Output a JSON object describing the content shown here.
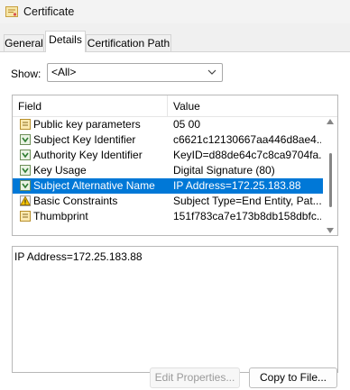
{
  "window": {
    "title": "Certificate",
    "icon": "certificate-icon"
  },
  "tabs": [
    {
      "label": "General",
      "active": false
    },
    {
      "label": "Details",
      "active": true
    },
    {
      "label": "Certification Path",
      "active": false
    }
  ],
  "show": {
    "label": "Show:",
    "selected": "<All>"
  },
  "list": {
    "columns": {
      "field": "Field",
      "value": "Value"
    },
    "rows": [
      {
        "field": "Public key parameters",
        "value": "05 00",
        "icon": "property-icon",
        "selected": false
      },
      {
        "field": "Subject Key Identifier",
        "value": "c6621c12130667aa446d8ae4...",
        "icon": "extension-icon",
        "selected": false
      },
      {
        "field": "Authority Key Identifier",
        "value": "KeyID=d88de64c7c8ca9704fa...",
        "icon": "extension-icon",
        "selected": false
      },
      {
        "field": "Key Usage",
        "value": "Digital Signature (80)",
        "icon": "extension-icon",
        "selected": false
      },
      {
        "field": "Subject Alternative Name",
        "value": "IP Address=172.25.183.88",
        "icon": "extension-icon",
        "selected": true
      },
      {
        "field": "Basic Constraints",
        "value": "Subject Type=End Entity, Pat...",
        "icon": "warning-extension-icon",
        "selected": false
      },
      {
        "field": "Thumbprint",
        "value": "151f783ca7e173b8db158dbfc...",
        "icon": "property-icon",
        "selected": false
      }
    ]
  },
  "detail_text": "IP Address=172.25.183.88",
  "buttons": {
    "edit_properties": "Edit Properties...",
    "copy_to_file": "Copy to File..."
  },
  "colors": {
    "selection": "#0078d7",
    "window_bg": "#f0f0f0"
  }
}
